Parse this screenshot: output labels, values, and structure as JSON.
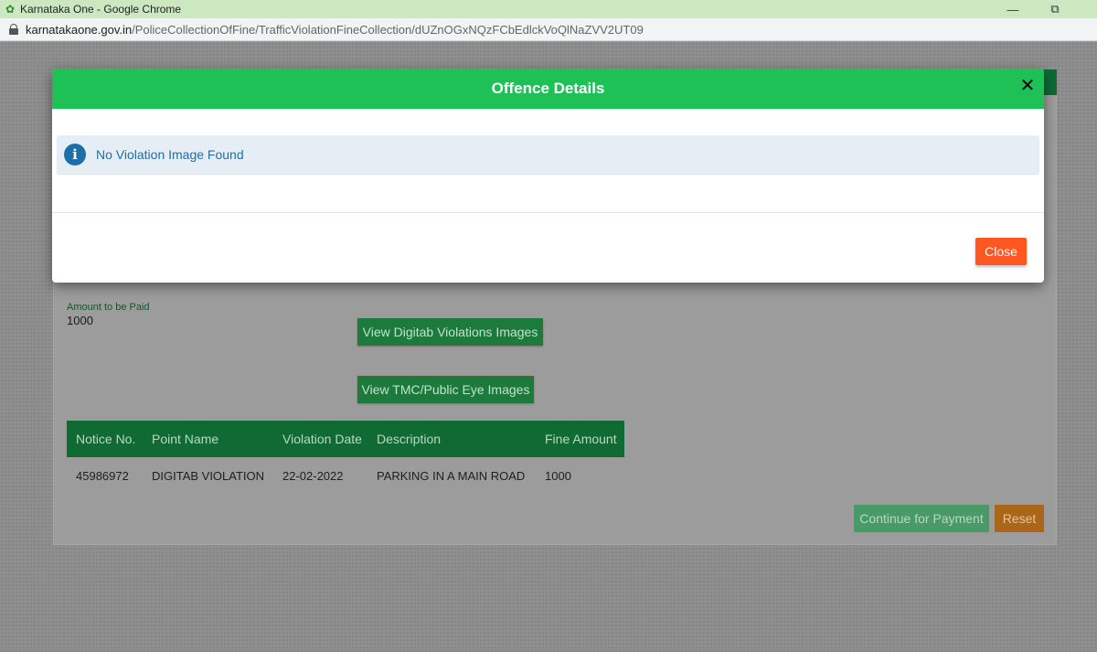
{
  "window": {
    "title": "Karnataka One - Google Chrome",
    "minimize_glyph": "—",
    "restore_glyph": "⧉"
  },
  "address_bar": {
    "domain": "karnatakaone.gov.in",
    "path": "/PoliceCollectionOfFine/TrafficViolationFineCollection/dUZnOGxNQzFCbEdlckVoQlNaZVV2UT09"
  },
  "page": {
    "amount_label": "Amount to be Paid",
    "amount_value": "1000",
    "view_digitab_button": "View Digitab Violations Images",
    "view_tmc_button": "View TMC/Public Eye Images",
    "table": {
      "headers": [
        "Notice No.",
        "Point Name",
        "Violation Date",
        "Description",
        "Fine Amount"
      ],
      "rows": [
        [
          "45986972",
          "DIGITAB VIOLATION",
          "22-02-2022",
          "PARKING IN A MAIN ROAD",
          "1000"
        ]
      ]
    },
    "continue_button": "Continue for Payment",
    "reset_button": "Reset"
  },
  "modal": {
    "title": "Offence Details",
    "close_x": "✕",
    "info_icon_glyph": "i",
    "alert_text": "No Violation Image Found",
    "close_button": "Close"
  },
  "colors": {
    "modal_header": "#1dc156",
    "close_button": "#ff5722",
    "info_text": "#1d6fa8",
    "titlebar": "#cbe8c0"
  }
}
